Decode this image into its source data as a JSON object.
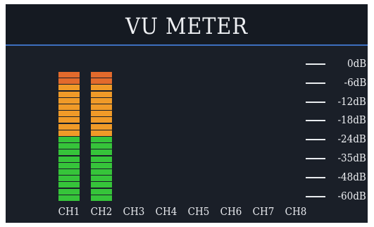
{
  "title": "VU METER",
  "colors": {
    "background": "#1a1f28",
    "divider": "#3d6fbf",
    "segment_green": "#36c43a",
    "segment_orange": "#f09a28",
    "segment_red": "#e36a2c"
  },
  "segments_per_meter": 20,
  "segment_zones": {
    "green_count": 10,
    "orange_count": 8,
    "red_count": 2
  },
  "channels": [
    {
      "label": "CH1",
      "level_segments": 20
    },
    {
      "label": "CH2",
      "level_segments": 20
    },
    {
      "label": "CH3",
      "level_segments": 0
    },
    {
      "label": "CH4",
      "level_segments": 0
    },
    {
      "label": "CH5",
      "level_segments": 0
    },
    {
      "label": "CH6",
      "level_segments": 0
    },
    {
      "label": "CH7",
      "level_segments": 0
    },
    {
      "label": "CH8",
      "level_segments": 0
    }
  ],
  "scale": [
    "0dB",
    "-6dB",
    "-12dB",
    "-18dB",
    "-24dB",
    "-35dB",
    "-48dB",
    "-60dB"
  ]
}
